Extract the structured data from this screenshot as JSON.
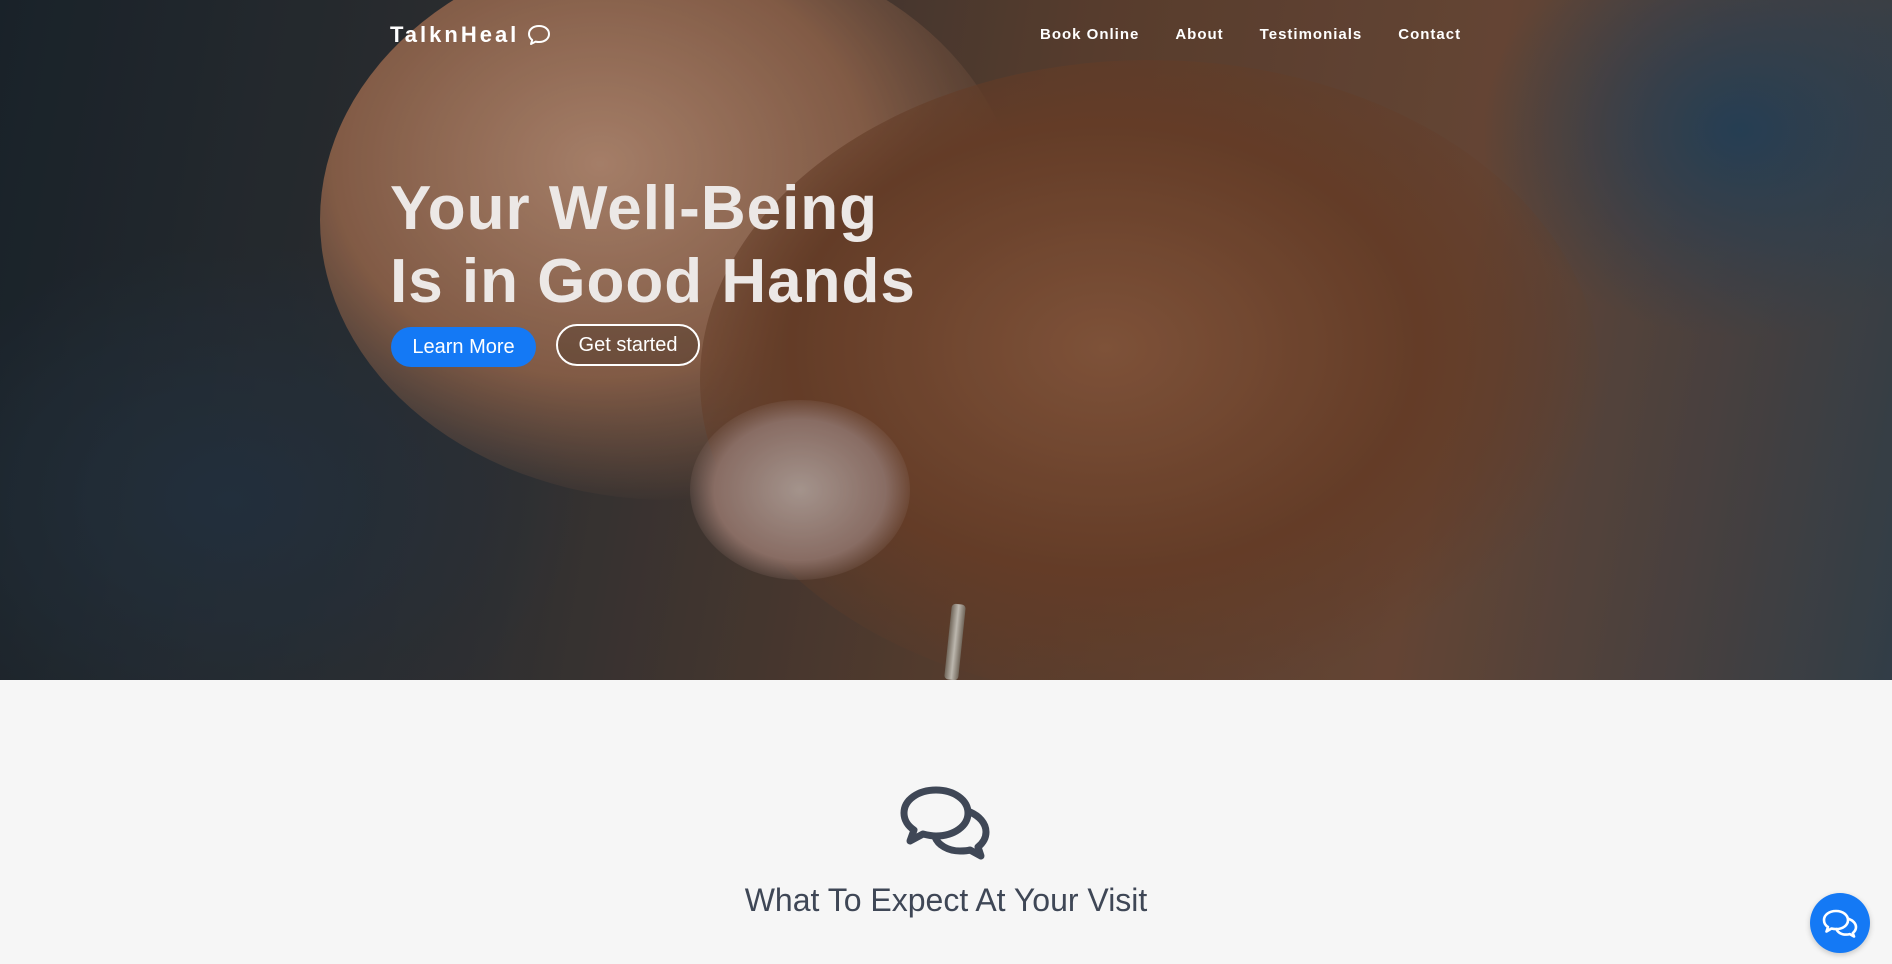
{
  "brand": {
    "name": "TalknHeal",
    "icon": "chat-bubble-icon"
  },
  "nav": {
    "items": [
      {
        "label": "Book Online"
      },
      {
        "label": "About"
      },
      {
        "label": "Testimonials"
      },
      {
        "label": "Contact"
      }
    ]
  },
  "hero": {
    "headline_line1": "Your Well-Being",
    "headline_line2": "Is in Good Hands",
    "primary_button": "Learn More",
    "secondary_button": "Get started",
    "background": "hands-photo"
  },
  "section": {
    "icon": "chat-bubbles-icon",
    "title": "What To Expect At Your Visit"
  },
  "chat_widget": {
    "icon": "chat-bubbles-icon"
  },
  "colors": {
    "accent": "#1479f5",
    "heading": "#3f4756",
    "section_bg": "#f6f6f6"
  }
}
